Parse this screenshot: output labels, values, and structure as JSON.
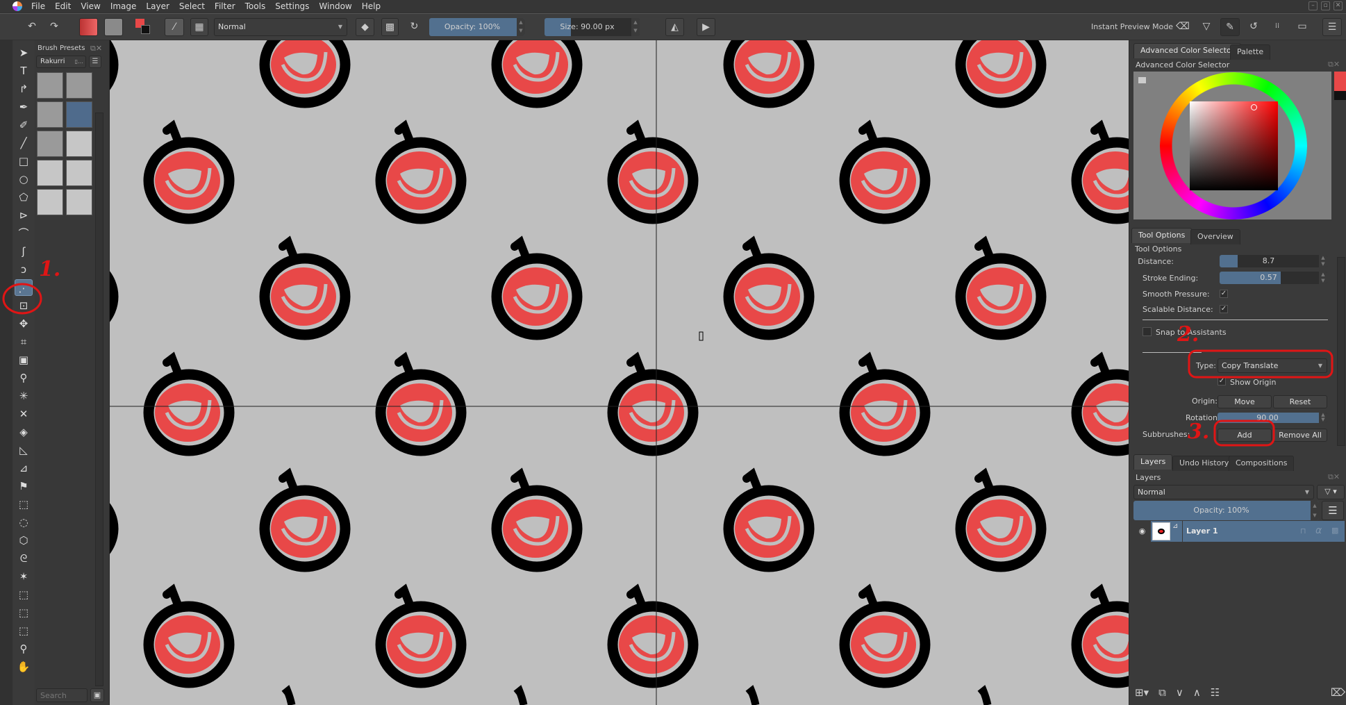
{
  "menu": [
    "File",
    "Edit",
    "View",
    "Image",
    "Layer",
    "Select",
    "Filter",
    "Tools",
    "Settings",
    "Window",
    "Help"
  ],
  "toolbar": {
    "blend_mode": "Normal",
    "opacity_label": "Opacity: 100%",
    "opacity_value": 100,
    "size_label": "Size: 90.00 px",
    "size_fill_fraction": 0.28,
    "instant_preview_label": "Instant Preview Mode"
  },
  "colors": {
    "foreground": "#e84848",
    "background": "#000000",
    "canvas_bg": "#bfbfbf",
    "accent": "#52708f",
    "annotation": "#e01515"
  },
  "brush_presets": {
    "title": "Brush Presets",
    "tag": "Rakurri",
    "search_placeholder": "Search",
    "presets": [
      "soft-round",
      "ink-squiggle",
      "smudge",
      "ink-pen",
      "blender",
      "multibrush-radial",
      "multibrush-symmetry",
      "multibrush-mirror-rotate",
      "multibrush-rotate",
      "multibrush-origin"
    ]
  },
  "color_selector": {
    "tabs": [
      "Advanced Color Selector",
      "Palette"
    ],
    "title": "Advanced Color Selector"
  },
  "tool_options": {
    "tabs": [
      "Tool Options",
      "Overview"
    ],
    "title": "Tool Options",
    "distance_label": "Distance:",
    "distance_value": "8.7",
    "distance_fraction": 0.17,
    "stroke_ending_label": "Stroke Ending:",
    "stroke_ending_value": "0.57",
    "stroke_ending_fraction": 0.57,
    "smooth_pressure_label": "Smooth Pressure:",
    "smooth_pressure": true,
    "scalable_distance_label": "Scalable Distance:",
    "scalable_distance": true,
    "snap_label": "Snap to Assistants",
    "snap": false,
    "type_label": "Type:",
    "type_value": "Copy Translate",
    "show_origin_label": "Show Origin",
    "show_origin": true,
    "origin_label": "Origin:",
    "move_button": "Move",
    "reset_button": "Reset",
    "rotation_label": "Rotation:",
    "rotation_value": "90.00",
    "subbrushes_label": "Subbrushes:",
    "add_button": "Add",
    "remove_all_button": "Remove All"
  },
  "layers": {
    "tabs": [
      "Layers",
      "Undo History",
      "Compositions"
    ],
    "title": "Layers",
    "blend_mode": "Normal",
    "opacity_label": "Opacity:  100%",
    "items": [
      {
        "name": "Layer 1",
        "visible": true
      }
    ]
  },
  "annotations": [
    "1.",
    "2.",
    "3."
  ]
}
